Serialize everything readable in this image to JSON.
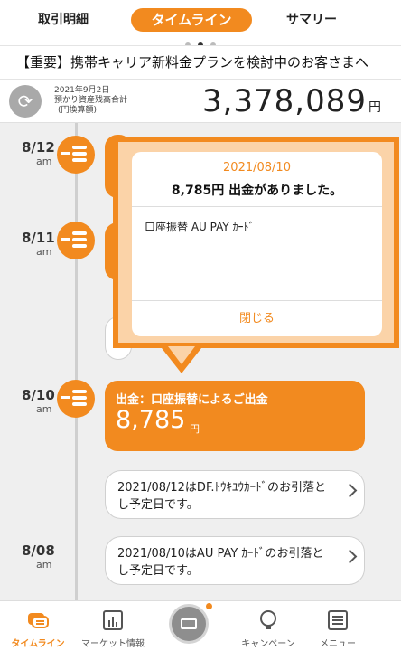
{
  "tabs": {
    "details": "取引明細",
    "timeline": "タイムライン",
    "summary": "サマリー"
  },
  "notice": "【重要】携帯キャリア新料金プランを検討中のお客さまへ",
  "balance": {
    "date_label": "2021年9月2日",
    "label1": "預かり資産残高合計",
    "label2": "(円換算額)",
    "amount": "3,378,089",
    "unit": "円"
  },
  "timeline": {
    "entries": [
      {
        "date": "8/12",
        "ampm": "am"
      },
      {
        "date": "8/11",
        "ampm": "am"
      },
      {
        "date": "8/10",
        "ampm": "am"
      },
      {
        "date": "8/08",
        "ampm": "am"
      }
    ],
    "withdrawal_card": {
      "title": "出金：口座振替によるご出金",
      "amount": "8,785",
      "unit": "円"
    },
    "notices": [
      "2021/08/12はDF.ﾄｳｷﾕｳｶｰﾄﾞのお引落とし予定日です。",
      "2021/08/10はAU PAY ｶｰﾄﾞのお引落とし予定日です。"
    ]
  },
  "popup": {
    "date": "2021/08/10",
    "title": "8,785円 出金がありました。",
    "body": "口座振替 AU PAY ｶｰﾄﾞ",
    "close": "閉じる"
  },
  "bottom_nav": {
    "items": [
      "タイムライン",
      "マーケット情報",
      "",
      "キャンペーン",
      "メニュー"
    ]
  },
  "colors": {
    "accent": "#f28a1f",
    "background": "#efefef"
  }
}
